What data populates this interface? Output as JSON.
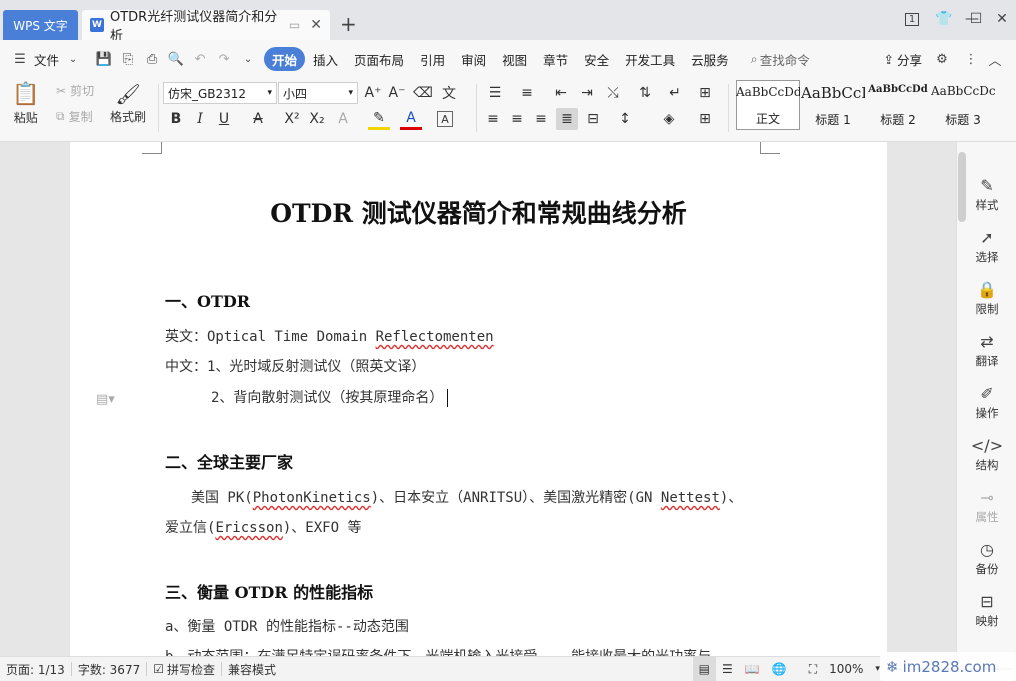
{
  "titlebar": {
    "app_tab": "WPS 文字",
    "doc_tab": "OTDR光纤测试仪器简介和分析",
    "doc_tab_icon": "W",
    "new_tab": "+",
    "page_indicator": "1"
  },
  "menubar": {
    "file": "文件",
    "tabs": [
      "开始",
      "插入",
      "页面布局",
      "引用",
      "审阅",
      "视图",
      "章节",
      "安全",
      "开发工具",
      "云服务"
    ],
    "search": "查找命令",
    "share": "分享"
  },
  "ribbon": {
    "paste": "粘贴",
    "cut": "剪切",
    "copy": "复制",
    "format_painter": "格式刷",
    "font_name": "仿宋_GB2312",
    "font_size": "小四",
    "styles": [
      {
        "preview": "AaBbCcDd",
        "name": "正文"
      },
      {
        "preview": "AaBbCcI",
        "name": "标题 1"
      },
      {
        "preview": "AaBbCcDd",
        "name": "标题 2"
      },
      {
        "preview": "AaBbCcDc",
        "name": "标题 3"
      }
    ]
  },
  "document": {
    "title": "OTDR 测试仪器简介和常规曲线分析",
    "s1_heading": "一、OTDR",
    "s1_en_label": "英文：Optical Time Domain ",
    "s1_en_word": "Reflectomenten",
    "s1_cn_1": "中文：1、光时域反射测试仪（照英文译）",
    "s1_cn_2": "2、背向散射测试仪（按其原理命名）",
    "s2_heading": "二、全球主要厂家",
    "s2_line1_a": "美国 PK(",
    "s2_line1_b": "PhotonKinetics",
    "s2_line1_c": ")、日本安立（ANRITSU）、美国激光精密(GN ",
    "s2_line1_d": "Nettest",
    "s2_line1_e": ")、",
    "s2_line2_a": "爱立信(",
    "s2_line2_b": "Ericsson",
    "s2_line2_c": ")、EXFO 等",
    "s3_heading": "三、衡量 OTDR 的性能指标",
    "s3_a": "a、衡量 OTDR 的性能指标--动态范围",
    "s3_b": "b、动态范围：在满足特定误码率条件下，光端机输入光接受... 能接收最大的光功率与..."
  },
  "rightpanel": [
    "样式",
    "选择",
    "限制",
    "翻译",
    "操作",
    "结构",
    "属性",
    "备份",
    "映射"
  ],
  "statusbar": {
    "page": "页面: 1/13",
    "words": "字数: 3677",
    "spellcheck": "拼写检查",
    "compat": "兼容模式",
    "zoom": "100%"
  },
  "watermark": "im2828.com",
  "colors": {
    "accent": "#4a7fd8",
    "squiggle": "#d33"
  }
}
